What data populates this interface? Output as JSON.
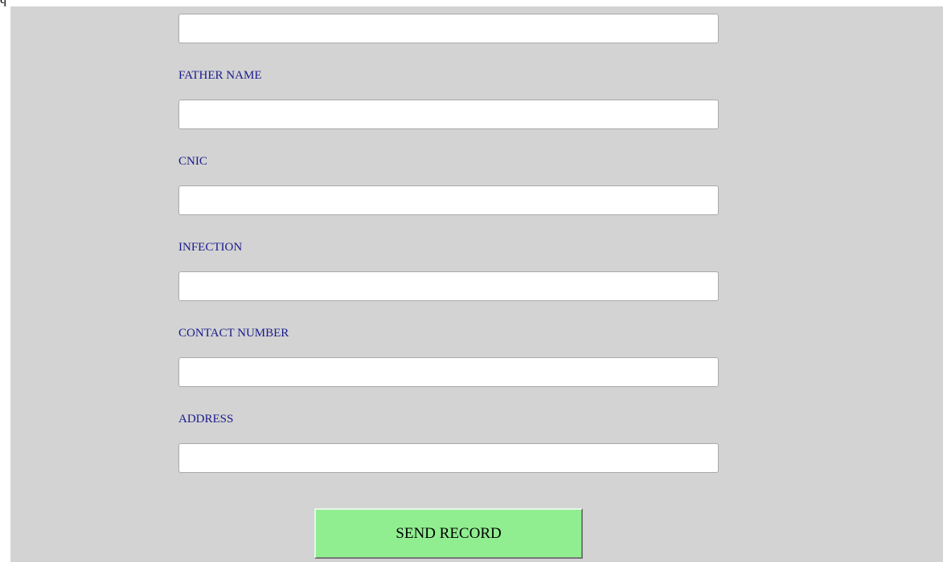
{
  "page": {
    "partial_heading_glyph": "q"
  },
  "form": {
    "fields": [
      {
        "label": "",
        "value": "",
        "placeholder": ""
      },
      {
        "label": "FATHER NAME",
        "value": "",
        "placeholder": ""
      },
      {
        "label": "CNIC",
        "value": "",
        "placeholder": ""
      },
      {
        "label": "INFECTION",
        "value": "",
        "placeholder": ""
      },
      {
        "label": "CONTACT NUMBER",
        "value": "",
        "placeholder": ""
      },
      {
        "label": "ADDRESS",
        "value": "",
        "placeholder": ""
      }
    ],
    "submit_label": "SEND RECORD"
  },
  "colors": {
    "panel_background": "#d3d3d3",
    "label_text": "#1a1a8c",
    "submit_background": "#90ee90",
    "input_background": "#ffffff"
  }
}
